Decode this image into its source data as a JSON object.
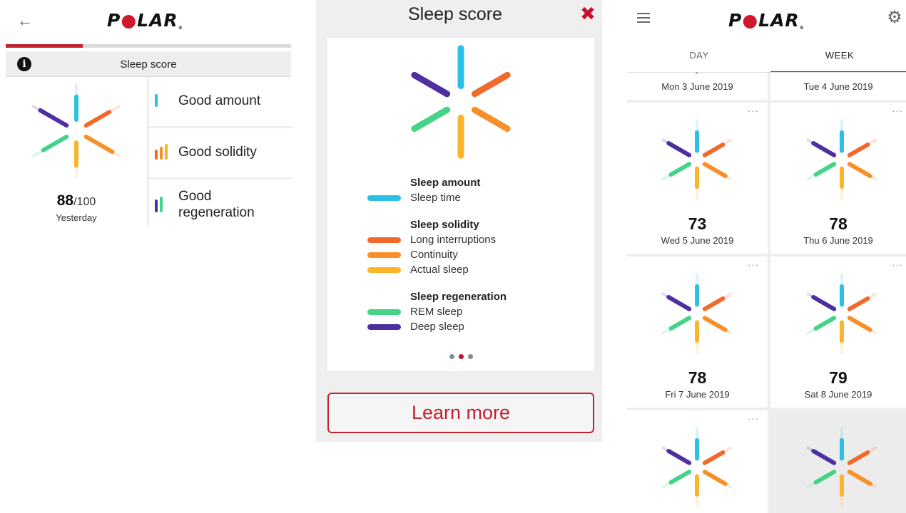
{
  "colors": {
    "brand_red": "#c8102e",
    "amount_blue": "#2cc0e6",
    "long_interruptions": "#f26a2b",
    "continuity": "#f7902a",
    "actual_sleep": "#fbb52a",
    "rem_sleep": "#43d487",
    "deep_sleep": "#4d2fa0"
  },
  "brand": {
    "logo_pre": "P",
    "logo_o": "●",
    "logo_post": "LAR",
    "logo_reg": "®"
  },
  "panel1": {
    "back_icon": "←",
    "progress_fraction": 0.27,
    "info_icon": "i",
    "header_label": "Sleep score",
    "score": "88",
    "score_max": "/100",
    "score_date": "Yesterday",
    "items": [
      {
        "label": "Good amount"
      },
      {
        "label": "Good solidity"
      },
      {
        "label": "Good regeneration"
      }
    ]
  },
  "panel2": {
    "title": "Sleep score",
    "close_icon": "✖",
    "legend": [
      {
        "heading": "Sleep amount",
        "rows": [
          {
            "label": "Sleep time",
            "color": "#2cc0e6"
          }
        ]
      },
      {
        "heading": "Sleep solidity",
        "rows": [
          {
            "label": "Long interruptions",
            "color": "#f26a2b"
          },
          {
            "label": "Continuity",
            "color": "#f7902a"
          },
          {
            "label": "Actual sleep",
            "color": "#fbb52a"
          }
        ]
      },
      {
        "heading": "Sleep regeneration",
        "rows": [
          {
            "label": "REM sleep",
            "color": "#43d487"
          },
          {
            "label": "Deep sleep",
            "color": "#4d2fa0"
          }
        ]
      }
    ],
    "page_count": 3,
    "active_page": 2,
    "learn_more": "Learn more"
  },
  "panel3": {
    "tabs": {
      "day": "DAY",
      "week": "WEEK"
    },
    "more_icon": "···",
    "gear_icon": "⚙",
    "top_row": [
      {
        "date": "Mon 3 June 2019"
      },
      {
        "date": "Tue 4 June 2019"
      }
    ],
    "days": [
      {
        "score": "73",
        "date": "Wed 5 June 2019"
      },
      {
        "score": "78",
        "date": "Thu 6 June 2019"
      },
      {
        "score": "78",
        "date": "Fri 7 June 2019"
      },
      {
        "score": "79",
        "date": "Sat 8 June 2019"
      }
    ]
  }
}
